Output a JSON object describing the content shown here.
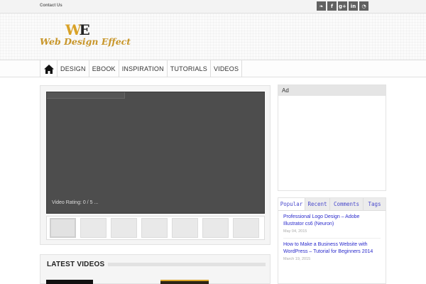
{
  "topbar": {
    "contact_label": "Contact Us",
    "social": [
      {
        "icon": "twitter-icon",
        "glyph": "❧"
      },
      {
        "icon": "facebook-icon",
        "glyph": "f"
      },
      {
        "icon": "google-plus-icon",
        "glyph": "g+"
      },
      {
        "icon": "linkedin-icon",
        "glyph": "in"
      },
      {
        "icon": "rss-icon",
        "glyph": "◔"
      }
    ]
  },
  "logo": {
    "mark_w": "W",
    "mark_e": "E",
    "text": "Web Design Effect"
  },
  "nav": {
    "home_icon": "home-icon",
    "items": [
      "DESIGN",
      "EBOOK",
      "INSPIRATION",
      "TUTORIALS",
      "VIDEOS"
    ]
  },
  "player": {
    "rating_text": "Video Rating: 0 / 5 ..."
  },
  "latest": {
    "title": "LATEST VIDEOS"
  },
  "ad": {
    "label": "Ad"
  },
  "tabs": {
    "labels": [
      "Popular",
      "Recent",
      "Comments",
      "Tags"
    ],
    "posts": [
      {
        "title": "Professional Logo Design – Adobe Illustrator cs6 (Neuron)",
        "date": "May 04, 2015"
      },
      {
        "title": "How to Make a Business Website with WordPress – Tutorial for Beginners 2014",
        "date": "March 19, 2015"
      }
    ]
  },
  "colors": {
    "brand_gold": "#d9a227",
    "link_blue": "#2a2acc",
    "social_bg": "#616161"
  }
}
